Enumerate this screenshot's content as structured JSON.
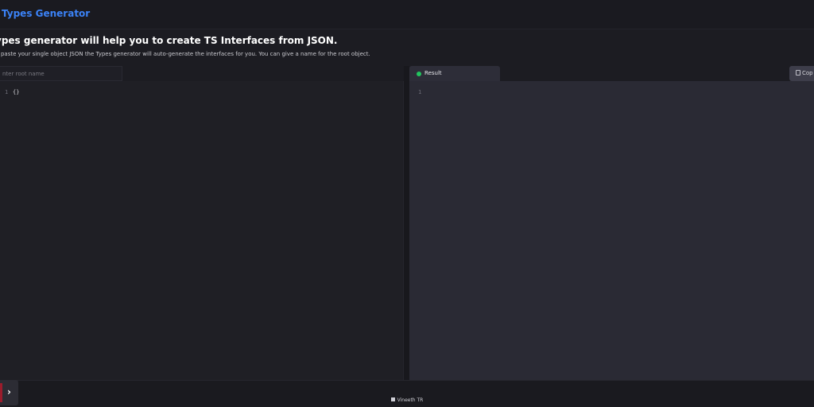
{
  "header": {
    "title": "Types Generator"
  },
  "intro": {
    "heading": "ypes generator will help you to create TS Interfaces from JSON.",
    "description": "t paste your single object JSON the Types generator will auto-generate the interfaces for you. You can give a name for the root object."
  },
  "left_panel": {
    "root_name_placeholder": "nter root name",
    "line_number": "1",
    "code": "{}"
  },
  "right_panel": {
    "tab_label": "Result",
    "status_color": "#22c55e",
    "line_number": "1",
    "copy_label": "Cop"
  },
  "footer": {
    "credit": "Vineeth TR"
  },
  "colors": {
    "accent": "#3b82f6",
    "background": "#1c1c22",
    "result_bg": "#2a2a34"
  }
}
